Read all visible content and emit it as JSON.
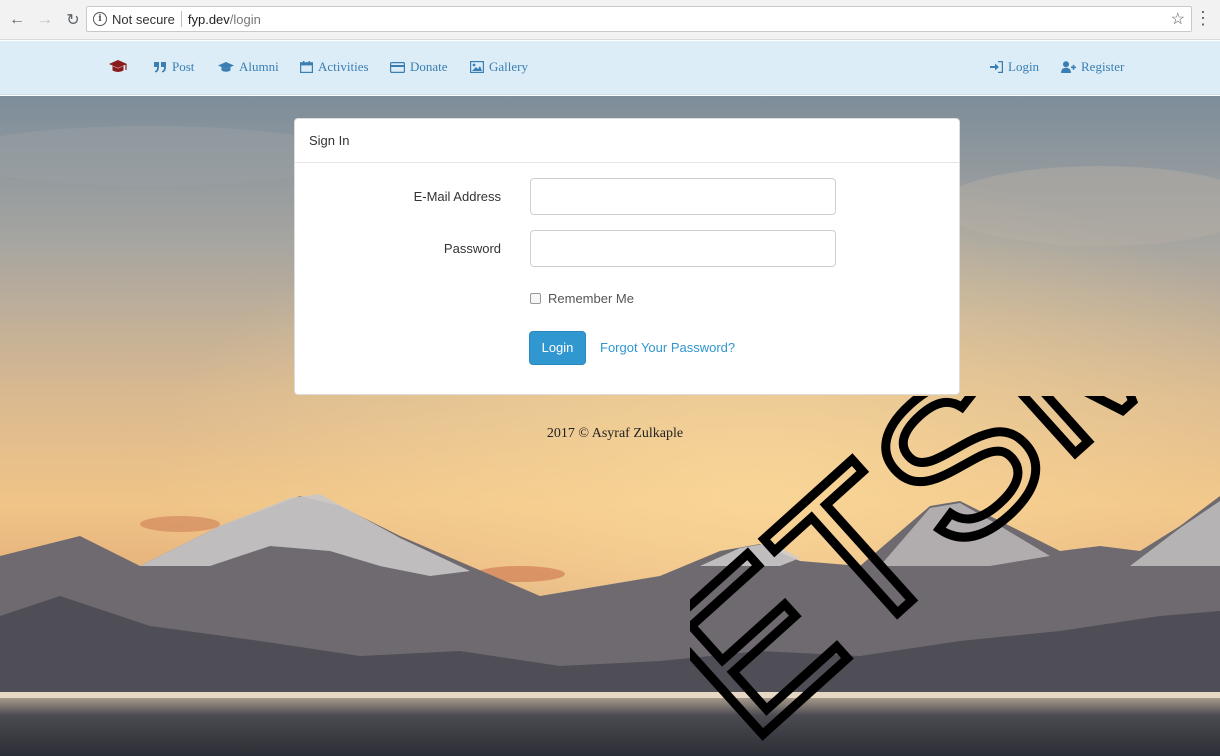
{
  "browser": {
    "security_label": "Not secure",
    "url_host": "fyp.dev",
    "url_path": "/login"
  },
  "navbar": {
    "left_items": [
      {
        "label": "Post",
        "icon": "quote-icon"
      },
      {
        "label": "Alumni",
        "icon": "graduation-cap-icon"
      },
      {
        "label": "Activities",
        "icon": "calendar-icon"
      },
      {
        "label": "Donate",
        "icon": "credit-card-icon"
      },
      {
        "label": "Gallery",
        "icon": "picture-icon"
      }
    ],
    "right_items": [
      {
        "label": "Login",
        "icon": "sign-in-icon"
      },
      {
        "label": "Register",
        "icon": "user-plus-icon"
      }
    ],
    "link_color": "#3a7eb3",
    "background": "#dcedf7"
  },
  "login_panel": {
    "heading": "Sign In",
    "email_label": "E-Mail Address",
    "email_value": "",
    "password_label": "Password",
    "password_value": "",
    "remember_label": "Remember Me",
    "remember_checked": false,
    "submit_label": "Login",
    "forgot_label": "Forgot Your Password?",
    "button_color": "#3097d1"
  },
  "footer": {
    "copyright": "2017 © Asyraf Zulkaple"
  },
  "watermark": "ETSM"
}
